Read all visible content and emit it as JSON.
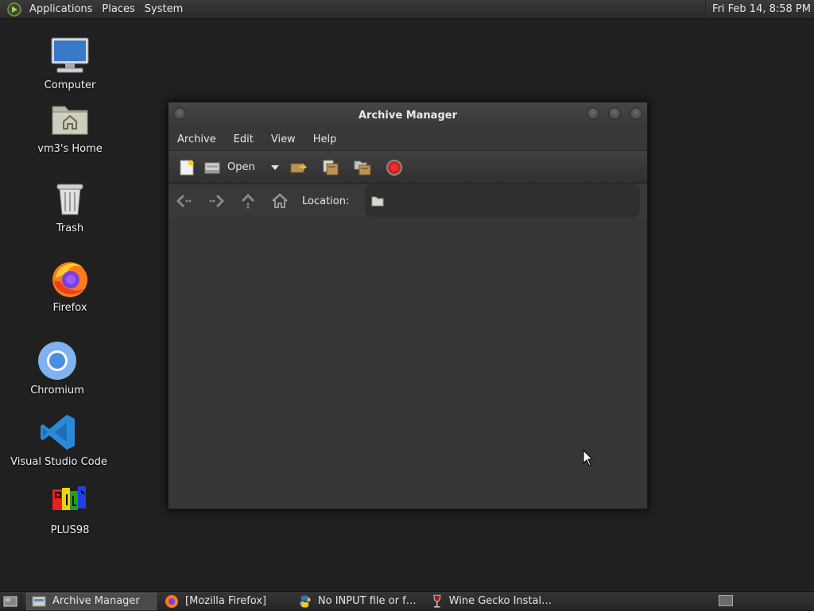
{
  "top_panel": {
    "menus": [
      "Applications",
      "Places",
      "System"
    ],
    "clock": "Fri Feb 14,  8:58 PM"
  },
  "desktop": {
    "icons": [
      {
        "label": "Computer",
        "icon": "computer-icon"
      },
      {
        "label": "vm3's Home",
        "icon": "home-folder-icon"
      },
      {
        "label": "Trash",
        "icon": "trash-icon"
      },
      {
        "label": "Firefox",
        "icon": "firefox-icon"
      },
      {
        "label": "Chromium",
        "icon": "chromium-icon"
      },
      {
        "label": "Visual Studio Code",
        "icon": "vscode-icon"
      },
      {
        "label": "PLUS98",
        "icon": "plus98-icon"
      }
    ]
  },
  "window": {
    "title": "Archive Manager",
    "menu": [
      "Archive",
      "Edit",
      "View",
      "Help"
    ],
    "toolbar": {
      "open_label": "Open",
      "buttons": [
        "new-archive-icon",
        "open-archive-icon",
        "extract-icon",
        "add-files-icon",
        "add-folder-icon",
        "stop-icon"
      ]
    },
    "location": {
      "label": "Location:",
      "value": ""
    }
  },
  "taskbar": {
    "tasks": [
      {
        "label": "Archive Manager",
        "icon": "archive-manager-icon",
        "active": true
      },
      {
        "label": "[Mozilla Firefox]",
        "icon": "firefox-icon",
        "active": false
      },
      {
        "label": "No INPUT file or fol…",
        "icon": "python-icon",
        "active": false
      },
      {
        "label": "Wine Gecko Installer",
        "icon": "wine-icon",
        "active": false
      }
    ]
  },
  "colors": {
    "desktop_bg": "#202020",
    "window_bg": "#363636",
    "stop_red": "#d02020",
    "firefox_orange": "#ff7a1a",
    "chromium_blue": "#4a8fe0",
    "vscode_blue": "#2a8ad8"
  }
}
